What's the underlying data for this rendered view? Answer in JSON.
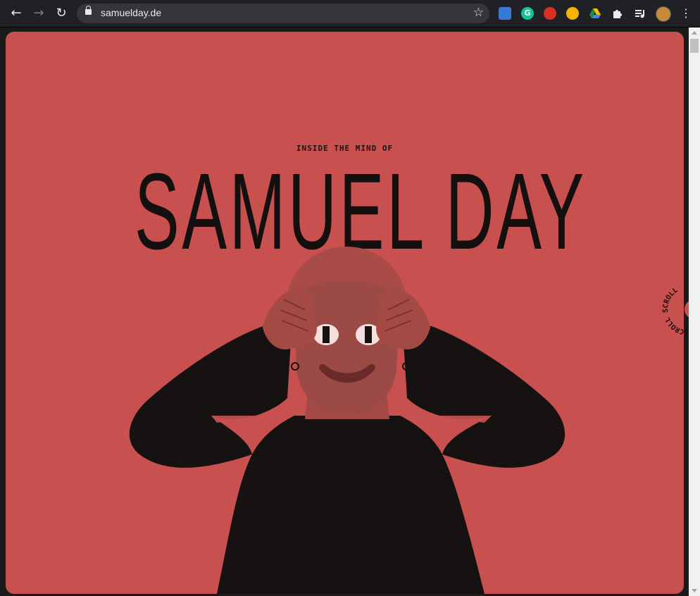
{
  "browser": {
    "url": "samuelday.de",
    "back_icon": "←",
    "forward_icon": "→",
    "reload_icon": "↻",
    "star_icon": "☆",
    "grammarly_letter": "G",
    "menu_icon": "⋮"
  },
  "hero": {
    "eyebrow": "INSIDE THE MIND OF",
    "title": "SAMUEL DAY",
    "scroll_label": "SCROLL SCROLL"
  },
  "colors": {
    "background": "#c8514f",
    "ink": "#141010",
    "mask": "#9c4a45"
  }
}
